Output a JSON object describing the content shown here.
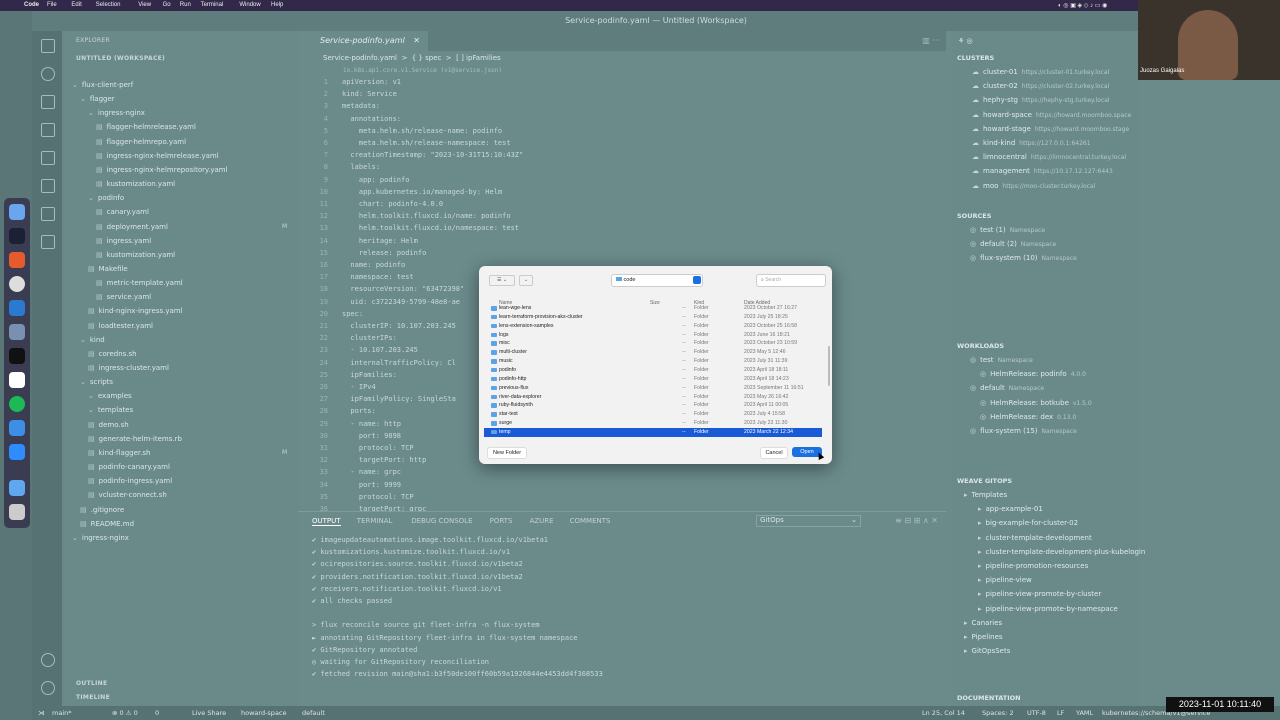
{
  "menubar": {
    "app": "Code",
    "items": [
      "File",
      "Edit",
      "Selection",
      "View",
      "Go",
      "Run",
      "Terminal",
      "Window",
      "Help"
    ]
  },
  "window_title": "Service-podinfo.yaml — Untitled (Workspace)",
  "explorer": {
    "title": "EXPLORER",
    "workspace": "UNTITLED (WORKSPACE)",
    "items": [
      {
        "label": "flux-client-perf",
        "depth": 0,
        "folder": true
      },
      {
        "label": "flagger",
        "depth": 1,
        "folder": true
      },
      {
        "label": "ingress-nginx",
        "depth": 2,
        "folder": true
      },
      {
        "label": "flagger-helmrelease.yaml",
        "depth": 3
      },
      {
        "label": "flagger-helmrepo.yaml",
        "depth": 3
      },
      {
        "label": "ingress-nginx-helmrelease.yaml",
        "depth": 3
      },
      {
        "label": "ingress-nginx-helmrepository.yaml",
        "depth": 3
      },
      {
        "label": "kustomization.yaml",
        "depth": 3
      },
      {
        "label": "podinfo",
        "depth": 2,
        "folder": true
      },
      {
        "label": "canary.yaml",
        "depth": 3
      },
      {
        "label": "deployment.yaml",
        "depth": 3,
        "mark": "M"
      },
      {
        "label": "ingress.yaml",
        "depth": 3
      },
      {
        "label": "kustomization.yaml",
        "depth": 3
      },
      {
        "label": "Makefile",
        "depth": 2
      },
      {
        "label": "metric-template.yaml",
        "depth": 3
      },
      {
        "label": "service.yaml",
        "depth": 3
      },
      {
        "label": "kind-nginx-ingress.yaml",
        "depth": 2
      },
      {
        "label": "loadtester.yaml",
        "depth": 2
      },
      {
        "label": "kind",
        "depth": 1,
        "folder": true
      },
      {
        "label": "coredns.sh",
        "depth": 2
      },
      {
        "label": "ingress-cluster.yaml",
        "depth": 2
      },
      {
        "label": "scripts",
        "depth": 1,
        "folder": true
      },
      {
        "label": "examples",
        "depth": 2,
        "folder": true
      },
      {
        "label": "templates",
        "depth": 2,
        "folder": true
      },
      {
        "label": "demo.sh",
        "depth": 2
      },
      {
        "label": "generate-helm-items.rb",
        "depth": 2
      },
      {
        "label": "kind-flagger.sh",
        "depth": 2,
        "mark": "M"
      },
      {
        "label": "podinfo-canary.yaml",
        "depth": 2
      },
      {
        "label": "podinfo-ingress.yaml",
        "depth": 2
      },
      {
        "label": "vcluster-connect.sh",
        "depth": 2
      },
      {
        "label": ".gitignore",
        "depth": 1
      },
      {
        "label": "README.md",
        "depth": 1
      },
      {
        "label": "ingress-nginx",
        "depth": 0,
        "folder": true
      }
    ],
    "outline": "OUTLINE",
    "timeline": "TIMELINE"
  },
  "editor": {
    "tab": "Service-podinfo.yaml",
    "breadcrumb": "Service-podinfo.yaml  >  { } spec  >  [ ] ipFamilies",
    "schema_hint": "io.k8s.api.core.v1.Service (v1@service.json)",
    "lines": [
      "apiVersion: v1",
      "kind: Service",
      "metadata:",
      "  annotations:",
      "    meta.helm.sh/release-name: podinfo",
      "    meta.helm.sh/release-namespace: test",
      "  creationTimestamp: \"2023-10-31T15:10:43Z\"",
      "  labels:",
      "    app: podinfo",
      "    app.kubernetes.io/managed-by: Helm",
      "    chart: podinfo-4.0.0",
      "    helm.toolkit.fluxcd.io/name: podinfo",
      "    helm.toolkit.fluxcd.io/namespace: test",
      "    heritage: Helm",
      "    release: podinfo",
      "  name: podinfo",
      "  namespace: test",
      "  resourceVersion: \"63472398\"",
      "  uid: c3722349-5799-48e8-ae",
      "spec:",
      "  clusterIP: 10.107.203.245",
      "  clusterIPs:",
      "  - 10.107.203.245",
      "  internalTrafficPolicy: Cl",
      "  ipFamilies:",
      "  - IPv4",
      "  ipFamilyPolicy: SingleSta",
      "  ports:",
      "  - name: http",
      "    port: 9898",
      "    protocol: TCP",
      "    targetPort: http",
      "  - name: grpc",
      "    port: 9999",
      "    protocol: TCP",
      "    targetPort: grpc"
    ]
  },
  "panel": {
    "tabs": [
      "OUTPUT",
      "TERMINAL",
      "DEBUG CONSOLE",
      "PORTS",
      "AZURE",
      "COMMENTS"
    ],
    "channel": "GitOps",
    "lines": [
      "✔ imageupdateautomations.image.toolkit.fluxcd.io/v1beta1",
      "✔ kustomizations.kustomize.toolkit.fluxcd.io/v1",
      "✔ ocirepositories.source.toolkit.fluxcd.io/v1beta2",
      "✔ providers.notification.toolkit.fluxcd.io/v1beta2",
      "✔ receivers.notification.toolkit.fluxcd.io/v1",
      "✔ all checks passed",
      "",
      "> flux reconcile source git fleet-infra -n flux-system",
      "► annotating GitRepository fleet-infra in flux-system namespace",
      "✔ GitRepository annotated",
      "◎ waiting for GitRepository reconciliation",
      "✔ fetched revision main@sha1:b3f50de100ff60b59a1926844e4453dd4f368533"
    ]
  },
  "gitops": {
    "clusters_title": "CLUSTERS",
    "clusters": [
      {
        "name": "cluster-01",
        "url": "https://cluster-01.turkey.local"
      },
      {
        "name": "cluster-02",
        "url": "https://cluster-02.turkey.local"
      },
      {
        "name": "hephy-stg",
        "url": "https://hephy-stg.turkey.local"
      },
      {
        "name": "howard-space",
        "url": "https://howard.moomboo.space"
      },
      {
        "name": "howard-stage",
        "url": "https://howard.moomboo.stage"
      },
      {
        "name": "kind-kind",
        "url": "https://127.0.0.1:64261"
      },
      {
        "name": "limnocentral",
        "url": "https://limnocentral.turkey.local"
      },
      {
        "name": "management",
        "url": "https://10.17.12.127:6443"
      },
      {
        "name": "moo",
        "url": "https://moo-cluster.turkey.local"
      }
    ],
    "sources_title": "SOURCES",
    "sources": [
      {
        "name": "test (1)",
        "kind": "Namespace"
      },
      {
        "name": "default (2)",
        "kind": "Namespace"
      },
      {
        "name": "flux-system (10)",
        "kind": "Namespace"
      }
    ],
    "workloads_title": "WORKLOADS",
    "workloads": [
      {
        "name": "test",
        "kind": "Namespace",
        "depth": 0
      },
      {
        "name": "HelmRelease: podinfo",
        "kind": "4.0.0",
        "depth": 1
      },
      {
        "name": "default",
        "kind": "Namespace",
        "depth": 0
      },
      {
        "name": "HelmRelease: botkube",
        "kind": "v1.5.0",
        "depth": 1
      },
      {
        "name": "HelmRelease: dex",
        "kind": "0.13.0",
        "depth": 1
      },
      {
        "name": "flux-system (15)",
        "kind": "Namespace",
        "depth": 0
      }
    ],
    "weave_title": "WEAVE GITOPS",
    "weave": [
      {
        "name": "Templates",
        "depth": 0
      },
      {
        "name": "app-example-01",
        "depth": 1
      },
      {
        "name": "big-example-for-cluster-02",
        "depth": 1
      },
      {
        "name": "cluster-template-development",
        "depth": 1
      },
      {
        "name": "cluster-template-development-plus-kubelogin",
        "depth": 1
      },
      {
        "name": "pipeline-promotion-resources",
        "depth": 1
      },
      {
        "name": "pipeline-view",
        "depth": 1
      },
      {
        "name": "pipeline-view-promote-by-cluster",
        "depth": 1
      },
      {
        "name": "pipeline-view-promote-by-namespace",
        "depth": 1
      },
      {
        "name": "Canaries",
        "depth": 0
      },
      {
        "name": "Pipelines",
        "depth": 0
      },
      {
        "name": "GitOpsSets",
        "depth": 0
      }
    ],
    "documentation": "DOCUMENTATION"
  },
  "status": {
    "branch": "main*",
    "errors": "⊗ 0  ⚠ 0",
    "ports": "0",
    "liveshare": "Live Share",
    "context": "howard-space",
    "namespace": "default",
    "position": "Ln 25, Col 14",
    "spaces": "Spaces: 2",
    "encoding": "UTF-8",
    "eol": "LF",
    "lang": "YAML",
    "schema": "kubernetes://schema/v1@service"
  },
  "webcam": {
    "name": "Juozas Gaigalas"
  },
  "timestamp": "2023-11-01  10:11:40",
  "dialog": {
    "location": "code",
    "search_placeholder": "Search",
    "headers": {
      "name": "Name",
      "size": "Size",
      "kind": "Kind",
      "date": "Date Added"
    },
    "rows": [
      {
        "name": "lean-wge-lens",
        "kind": "Folder",
        "date": "2023 October 27 16:27"
      },
      {
        "name": "learn-terraform-provision-aks-cluster",
        "kind": "Folder",
        "date": "2023 July 25 18:25"
      },
      {
        "name": "lens-extension-samples",
        "kind": "Folder",
        "date": "2023 October 25 16:58"
      },
      {
        "name": "logs",
        "kind": "Folder",
        "date": "2023 June 16 18:21"
      },
      {
        "name": "misc",
        "kind": "Folder",
        "date": "2023 October 23 10:59"
      },
      {
        "name": "multi-cluster",
        "kind": "Folder",
        "date": "2023 May 5 12:46"
      },
      {
        "name": "music",
        "kind": "Folder",
        "date": "2023 July 31 11:39"
      },
      {
        "name": "podinfo",
        "kind": "Folder",
        "date": "2023 April 18 18:11"
      },
      {
        "name": "podinfo-http",
        "kind": "Folder",
        "date": "2023 April 18 14:23"
      },
      {
        "name": "previous-flux",
        "kind": "Folder",
        "date": "2023 September 11 16:51"
      },
      {
        "name": "river-data-explorer",
        "kind": "Folder",
        "date": "2023 May 26 16:42"
      },
      {
        "name": "ruby-fluidsynth",
        "kind": "Folder",
        "date": "2023 April 11 00:05"
      },
      {
        "name": "star-test",
        "kind": "Folder",
        "date": "2023 July 4 15:58"
      },
      {
        "name": "surge",
        "kind": "Folder",
        "date": "2023 July 23 11:30"
      },
      {
        "name": "temp",
        "kind": "Folder",
        "date": "2023 March 22 12:34",
        "selected": true
      }
    ],
    "new_folder": "New Folder",
    "cancel": "Cancel",
    "open": "Open"
  }
}
